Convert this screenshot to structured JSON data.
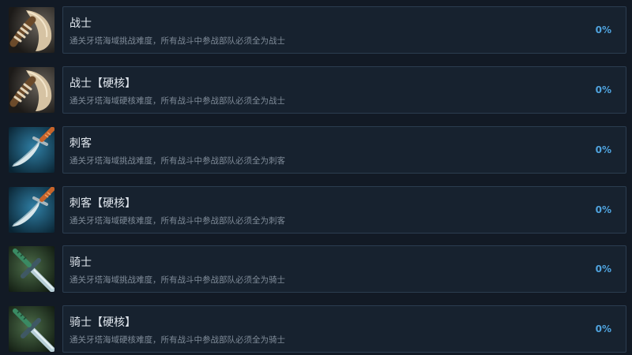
{
  "achievements": [
    {
      "title": "战士",
      "description": "通关牙塔海域挑战难度，所有战斗中参战部队必须全为战士",
      "percent": "0%",
      "icon": "axe-icon"
    },
    {
      "title": "战士【硬核】",
      "description": "通关牙塔海域硬核难度，所有战斗中参战部队必须全为战士",
      "percent": "0%",
      "icon": "axe-icon"
    },
    {
      "title": "刺客",
      "description": "通关牙塔海域挑战难度，所有战斗中参战部队必须全为刺客",
      "percent": "0%",
      "icon": "dagger-icon"
    },
    {
      "title": "刺客【硬核】",
      "description": "通关牙塔海域硬核难度，所有战斗中参战部队必须全为刺客",
      "percent": "0%",
      "icon": "dagger-icon"
    },
    {
      "title": "骑士",
      "description": "通关牙塔海域挑战难度，所有战斗中参战部队必须全为骑士",
      "percent": "0%",
      "icon": "sword-icon"
    },
    {
      "title": "骑士【硬核】",
      "description": "通关牙塔海域硬核难度，所有战斗中参战部队必须全为骑士",
      "percent": "0%",
      "icon": "sword-icon"
    }
  ]
}
